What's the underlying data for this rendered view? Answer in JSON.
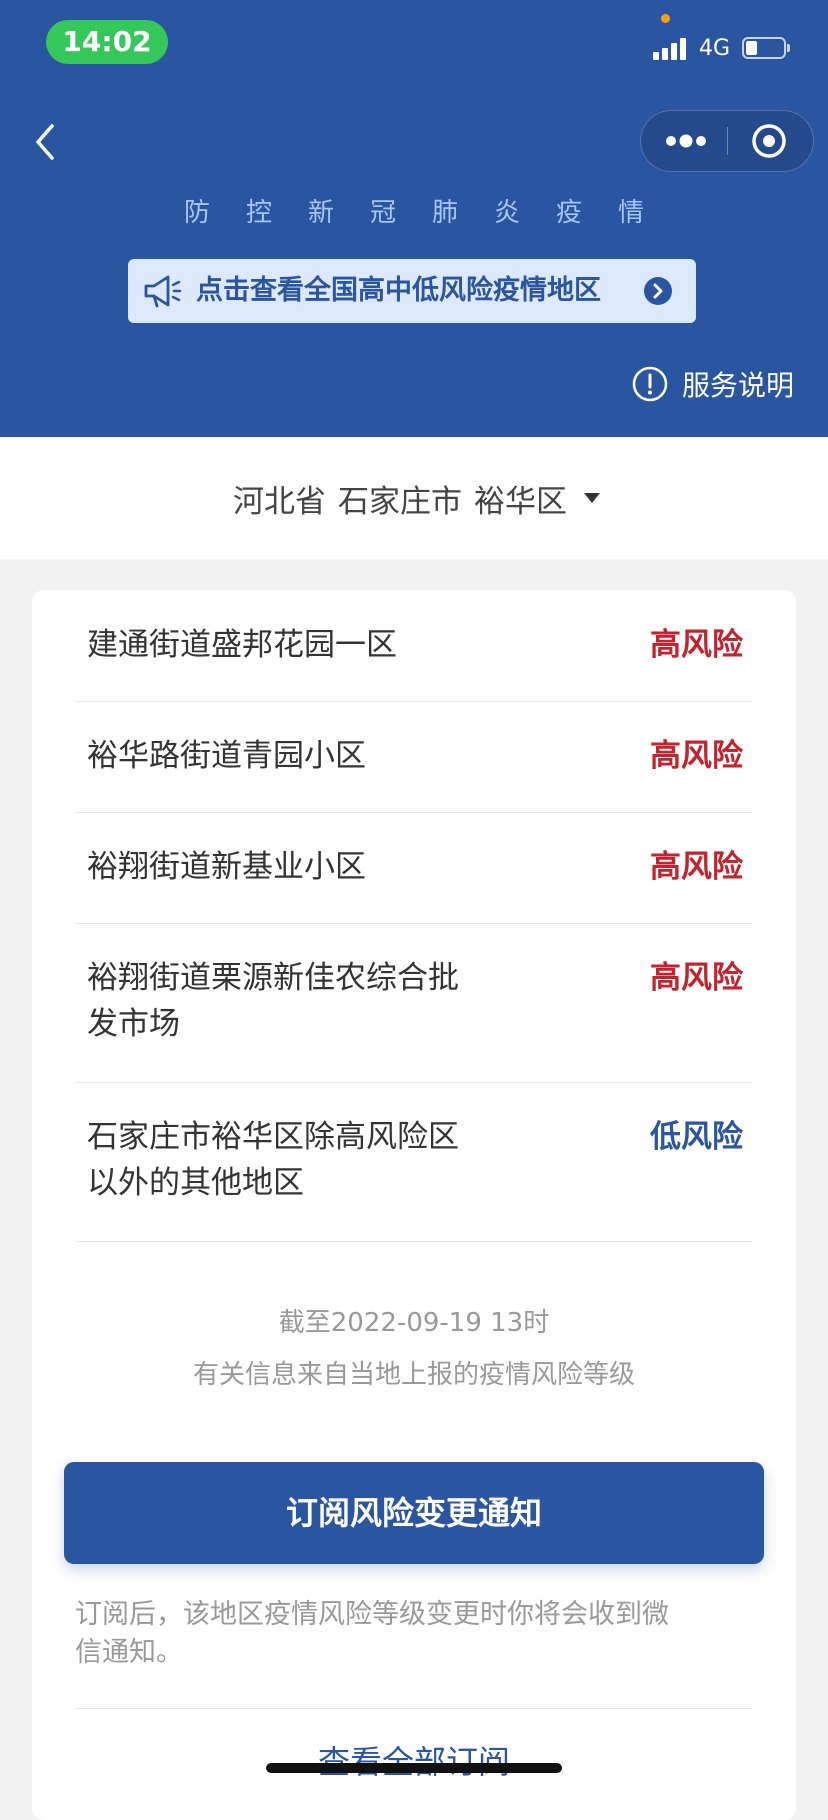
{
  "status_bar": {
    "time": "14:02",
    "network": "4G",
    "battery_level": 0.25
  },
  "nav": {
    "back_icon": "chevron-left-icon",
    "more_icon": "more-dots-icon",
    "close_icon": "mini-program-close-icon"
  },
  "header": {
    "title_chars": [
      "防",
      "控",
      "新",
      "冠",
      "肺",
      "炎",
      "疫",
      "情"
    ],
    "notice": {
      "icon": "megaphone-icon",
      "text": "点击查看全国高中低风险疫情地区",
      "arrow_icon": "chevron-right-circle-icon"
    },
    "service": {
      "icon": "info-circle-icon",
      "label": "服务说明"
    }
  },
  "region": {
    "province": "河北省",
    "city": "石家庄市",
    "district": "裕华区",
    "dropdown_icon": "caret-down-icon"
  },
  "areas": [
    {
      "line1": "建通街道盛邦花园一区",
      "line2": "",
      "risk": "高风险",
      "level": "high"
    },
    {
      "line1": "裕华路街道青园小区",
      "line2": "",
      "risk": "高风险",
      "level": "high"
    },
    {
      "line1": "裕翔街道新基业小区",
      "line2": "",
      "risk": "高风险",
      "level": "high"
    },
    {
      "line1": "裕翔街道栗源新佳农综合批",
      "line2": "发市场",
      "risk": "高风险",
      "level": "high"
    },
    {
      "line1": "石家庄市裕华区除高风险区",
      "line2": "以外的其他地区",
      "risk": "低风险",
      "level": "low"
    }
  ],
  "footnote": {
    "as_of": "截至2022-09-19 13时",
    "source": "有关信息来自当地上报的疫情风险等级"
  },
  "subscribe": {
    "button_label": "订阅风险变更通知",
    "desc_line1": "订阅后，该地区疫情风险等级变更时你将会收到微",
    "desc_line2": "信通知。"
  },
  "view_all_label": "查看全部订阅",
  "colors": {
    "header_blue": "#2a55a1",
    "high_risk": "#c4222d",
    "low_risk": "#2a55a1",
    "time_pill": "#34c759"
  }
}
